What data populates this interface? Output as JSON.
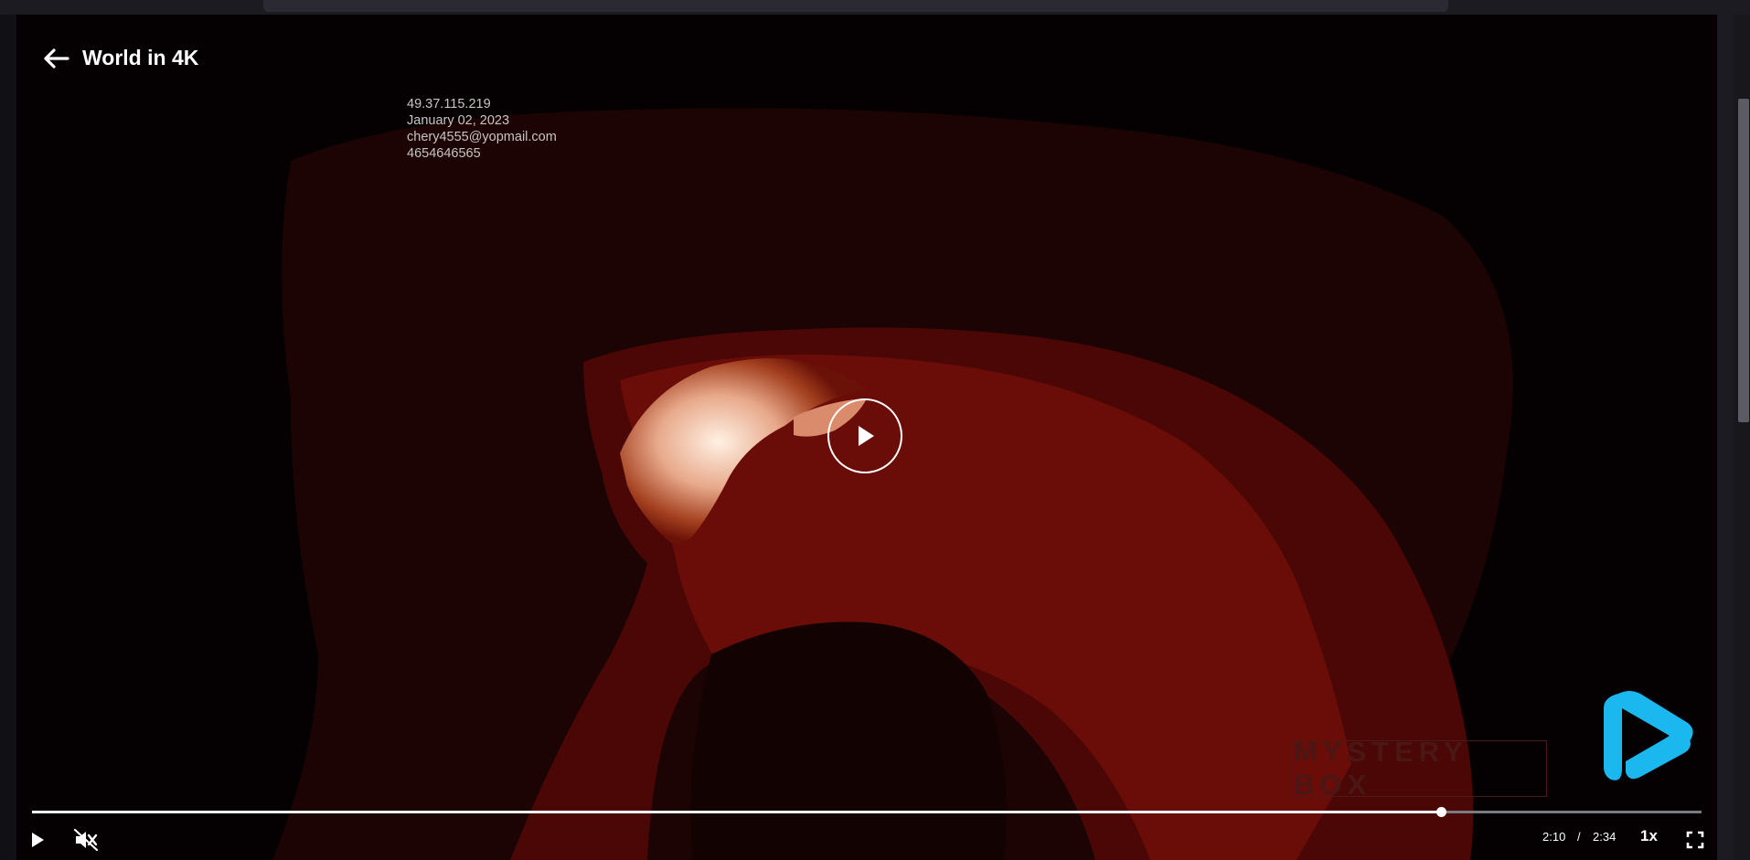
{
  "player": {
    "title": "World in 4K",
    "watermark": {
      "ip": "49.37.115.219",
      "date": "January 02, 2023",
      "email": "chery4555@yopmail.com",
      "phone": "4654646565"
    },
    "overlay_text": "MYSTERY BOX",
    "current_time": "2:10",
    "time_separator": "/",
    "duration": "2:34",
    "progress": 0.844,
    "speed": "1x"
  },
  "colors": {
    "background": "#050102",
    "accent_logo": "#1ab8ef",
    "progress_played": "#ffffff",
    "progress_remaining": "#7a7b80"
  },
  "icons": {
    "back": "arrow-left-icon",
    "play": "play-icon",
    "mute": "volume-muted-icon",
    "fullscreen": "fullscreen-icon",
    "logo": "brand-logo-icon"
  }
}
